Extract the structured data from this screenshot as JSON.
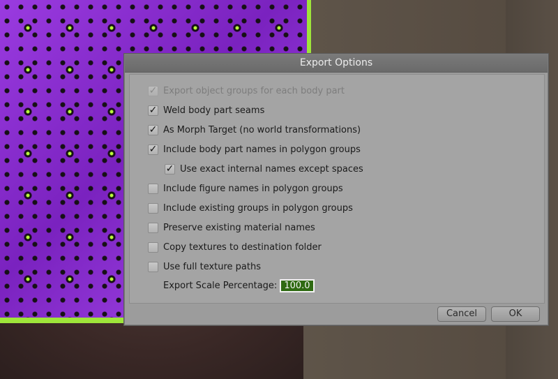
{
  "dialog": {
    "title": "Export Options",
    "options": [
      {
        "label": "Export object groups for each body part",
        "checked": true,
        "disabled": true
      },
      {
        "label": "Weld body part seams",
        "checked": true,
        "disabled": false
      },
      {
        "label": "As Morph Target (no world transformations)",
        "checked": true,
        "disabled": false
      },
      {
        "label": "Include body part names in polygon groups",
        "checked": true,
        "disabled": false
      },
      {
        "label": "Use exact internal names except spaces",
        "checked": true,
        "disabled": false
      },
      {
        "label": "Include figure names in polygon groups",
        "checked": false,
        "disabled": false
      },
      {
        "label": "Include existing groups in polygon groups",
        "checked": false,
        "disabled": false
      },
      {
        "label": "Preserve existing material names",
        "checked": false,
        "disabled": false
      },
      {
        "label": "Copy textures to destination folder",
        "checked": false,
        "disabled": false
      },
      {
        "label": "Use full texture paths",
        "checked": false,
        "disabled": false
      }
    ],
    "scale_label": "Export Scale Percentage:",
    "scale_value": "100.00",
    "cancel_label": "Cancel",
    "ok_label": "OK",
    "check_glyph": "✓"
  },
  "colors": {
    "shirt": "#8a2fd0",
    "trim": "#9ee53a",
    "scale_field_bg": "#2f6a12"
  }
}
